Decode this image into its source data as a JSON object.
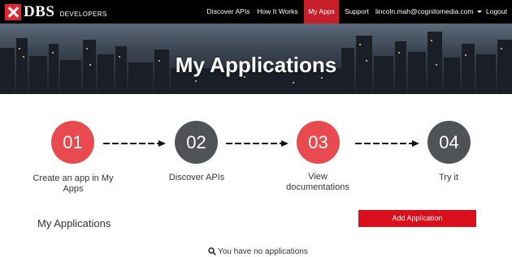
{
  "brand": {
    "name": "DBS",
    "subtitle": "DEVELOPERS",
    "accent": "#e3262d"
  },
  "nav": {
    "items": [
      {
        "label": "Discover APIs",
        "active": false
      },
      {
        "label": "How It Works",
        "active": false
      },
      {
        "label": "My Apps",
        "active": true
      },
      {
        "label": "Support",
        "active": false
      },
      {
        "label": "lincoln.mah@cognitomedia.com",
        "active": false,
        "dropdown": true
      },
      {
        "label": "Logout",
        "active": false
      }
    ]
  },
  "hero": {
    "title": "My Applications"
  },
  "steps": [
    {
      "number": "01",
      "label": "Create an app in My Apps",
      "color": "#e84a4f"
    },
    {
      "number": "02",
      "label": "Discover APIs",
      "color": "#4f5355"
    },
    {
      "number": "03",
      "label": "View documentations",
      "color": "#e84a4f"
    },
    {
      "number": "04",
      "label": "Try it",
      "color": "#4f5355"
    }
  ],
  "apps": {
    "title": "My Applications",
    "add_button": "Add Application",
    "empty_message": "You have no applications"
  }
}
